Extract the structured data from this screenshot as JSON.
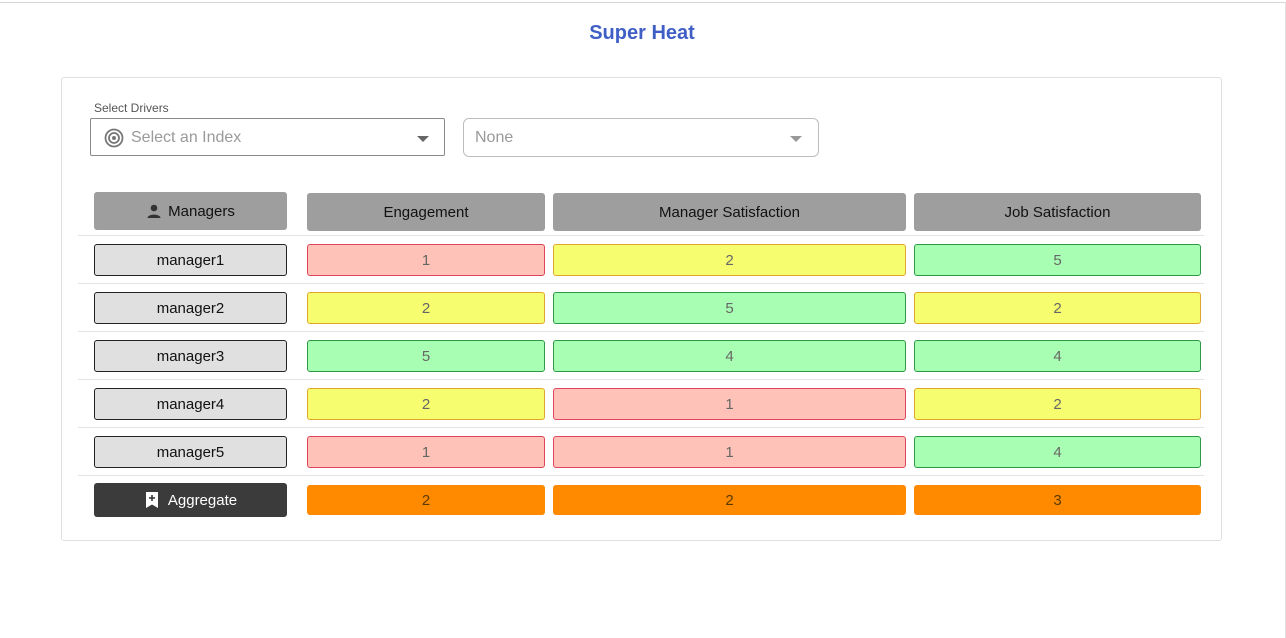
{
  "title": "Super Heat",
  "drivers": {
    "label": "Select Drivers",
    "index_placeholder": "Select an Index",
    "second_value": "None"
  },
  "table": {
    "managers_header": "Managers",
    "columns": [
      "Engagement",
      "Manager Satisfaction",
      "Job Satisfaction"
    ],
    "rows": [
      {
        "manager": "manager1",
        "values": [
          "1",
          "2",
          "5"
        ]
      },
      {
        "manager": "manager2",
        "values": [
          "2",
          "5",
          "2"
        ]
      },
      {
        "manager": "manager3",
        "values": [
          "5",
          "4",
          "4"
        ]
      },
      {
        "manager": "manager4",
        "values": [
          "2",
          "1",
          "2"
        ]
      },
      {
        "manager": "manager5",
        "values": [
          "1",
          "1",
          "4"
        ]
      }
    ],
    "aggregate_label": "Aggregate",
    "aggregate_values": [
      "2",
      "2",
      "3"
    ]
  },
  "colors": {
    "title": "#3f5fc7",
    "low_fill": "#ffc2b8",
    "low_border": "#e0455e",
    "mid_fill": "#f6fd6f",
    "mid_border": "#e0a82a",
    "high_fill": "#a8ffb4",
    "high_border": "#2e9a46",
    "aggregate_fill": "#ff8a00",
    "header_fill": "#9e9e9e",
    "aggregate_button": "#3b3b3b"
  },
  "icons": {
    "index_select": "target-icon",
    "managers_header": "person-icon",
    "aggregate": "bookmark-plus-icon",
    "dropdown": "caret-down-icon"
  }
}
